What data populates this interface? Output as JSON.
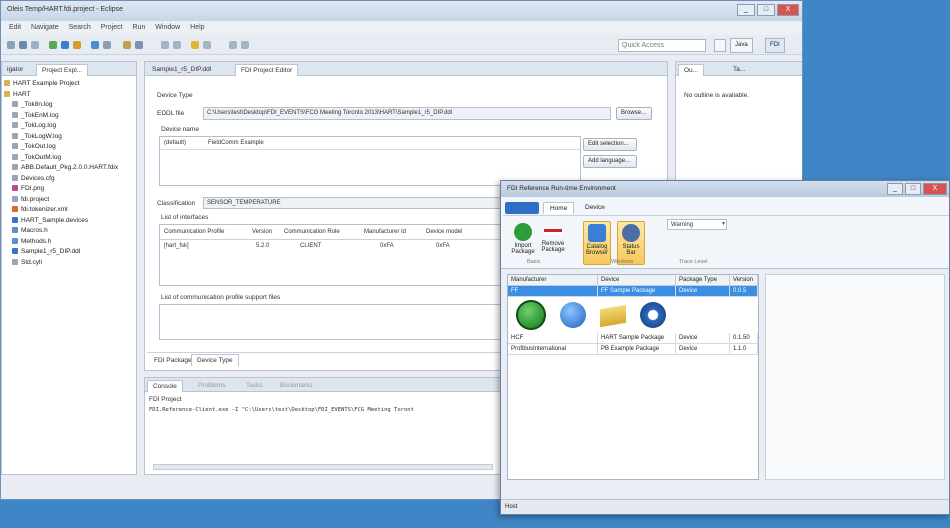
{
  "eclipse": {
    "title": "Oleis Temp/HART.fdi.project - Eclipse",
    "menu": [
      "Edit",
      "Navigate",
      "Search",
      "Project",
      "Run",
      "Window",
      "Help"
    ],
    "quick_access_placeholder": "Quick Access",
    "perspectives": [
      "Java",
      "FDI"
    ],
    "win_buttons": [
      "_",
      "□",
      "X"
    ]
  },
  "navigator": {
    "tabs": [
      "igator",
      "Project Expl..."
    ],
    "items": [
      {
        "label": "HART Example Project",
        "icon": "folder",
        "level": 0
      },
      {
        "label": "HART",
        "icon": "folder",
        "level": 0
      },
      {
        "label": "_Tok8n.log",
        "icon": "file",
        "level": 1
      },
      {
        "label": "_TokEnM.log",
        "icon": "file",
        "level": 1
      },
      {
        "label": "_TokLog.log",
        "icon": "file",
        "level": 1
      },
      {
        "label": "_TokLogW.log",
        "icon": "file",
        "level": 1
      },
      {
        "label": "_TokOut.log",
        "icon": "file",
        "level": 1
      },
      {
        "label": "_TokOutM.log",
        "icon": "file",
        "level": 1
      },
      {
        "label": "ABB.Default_Pkg.2.0.0.HART.fdix",
        "icon": "file",
        "level": 1
      },
      {
        "label": "Devices.cfg",
        "icon": "file",
        "level": 1
      },
      {
        "label": "FDI.png",
        "icon": "image",
        "level": 1
      },
      {
        "label": "fdi.project",
        "icon": "file",
        "level": 1
      },
      {
        "label": "fdi.tokenizer.xml",
        "icon": "xml",
        "level": 1
      },
      {
        "label": "HART_Sample.devices",
        "icon": "device",
        "level": 1
      },
      {
        "label": "Macros.h",
        "icon": "h",
        "level": 1
      },
      {
        "label": "Methods.h",
        "icon": "h",
        "level": 1
      },
      {
        "label": "Sample1_r5_DIP.ddl",
        "icon": "device",
        "level": 1
      },
      {
        "label": "Std.cyll",
        "icon": "file",
        "level": 1
      }
    ]
  },
  "editor": {
    "tabs": [
      "Sample1_r5_DIP.ddl",
      "FDI Project Editor"
    ],
    "device_type_heading": "Device Type",
    "eddl_file_label": "EDDL file",
    "eddl_file_value": "C:\\Users\\test\\Desktop\\FDI_EVENTS\\FCG Meeting Toronto 2013\\HART\\Sample1_r5_DIP.ddl",
    "browse_label": "Browse...",
    "device_name_label": "Device name",
    "device_name_row": [
      "(default)",
      "FieldComm Example"
    ],
    "edit_selection_label": "Edit selection...",
    "add_language_label": "Add language...",
    "classification_label": "Classification",
    "classification_value": "SENSOR_TEMPERATURE",
    "interfaces_label": "List of interfaces",
    "interfaces_columns": [
      "Communication Profile",
      "Version",
      "Communication Role",
      "Manufacturer Id",
      "Device model"
    ],
    "interfaces_row": [
      "[hart_fsk]",
      "5.2.0",
      "CLIENT",
      "0xFA",
      "0xFA"
    ],
    "support_files_label": "List of communication profile support files",
    "bottom_tabs": [
      "FDI Package",
      "Device Type"
    ]
  },
  "outline": {
    "tabs": [
      "Ou...",
      "Ta..."
    ],
    "message": "No outline is available."
  },
  "console": {
    "tabs": [
      "Console",
      "Problems",
      "Tasks",
      "Bookmarks"
    ],
    "heading": "FDI Project",
    "line": "FDI.Reference-Client.exe -I \"C:\\Users\\test\\Desktop\\FDI_EVENTS\\FCG Meeting Toront"
  },
  "fdi": {
    "title": "FDI Reference Run-time Environment",
    "win_buttons": [
      "_",
      "□",
      "X"
    ],
    "ribbon_tabs": [
      "Home",
      "Device"
    ],
    "buttons": [
      {
        "label": "Import Package",
        "icon": "import-icon",
        "color": "#2a9c3a"
      },
      {
        "label": "Remove Package",
        "icon": "remove-icon",
        "color": "#c8242b"
      },
      {
        "label": "Catalog Browser",
        "icon": "catalog-icon",
        "color": "#3a7fd5"
      },
      {
        "label": "Status Bar",
        "icon": "statusbar-icon",
        "color": "#4a6fa5"
      }
    ],
    "group_labels": [
      "Basic",
      "Windows",
      "Trace Level"
    ],
    "trace_level_value": "Warning",
    "table_columns": [
      "Manufacturer",
      "Device",
      "Package Type",
      "Version"
    ],
    "rows": [
      {
        "cells": [
          "FF",
          "FF Sample Package",
          "Device",
          "0.0.5"
        ],
        "selected": true
      },
      {
        "cells": [
          "HCF",
          "HART Sample Package",
          "Device",
          "0.1.50"
        ],
        "selected": false
      },
      {
        "cells": [
          "ProfibusInternational",
          "PB Example Package",
          "Device",
          "1.1.0"
        ],
        "selected": false
      }
    ],
    "status_text": "Host"
  }
}
